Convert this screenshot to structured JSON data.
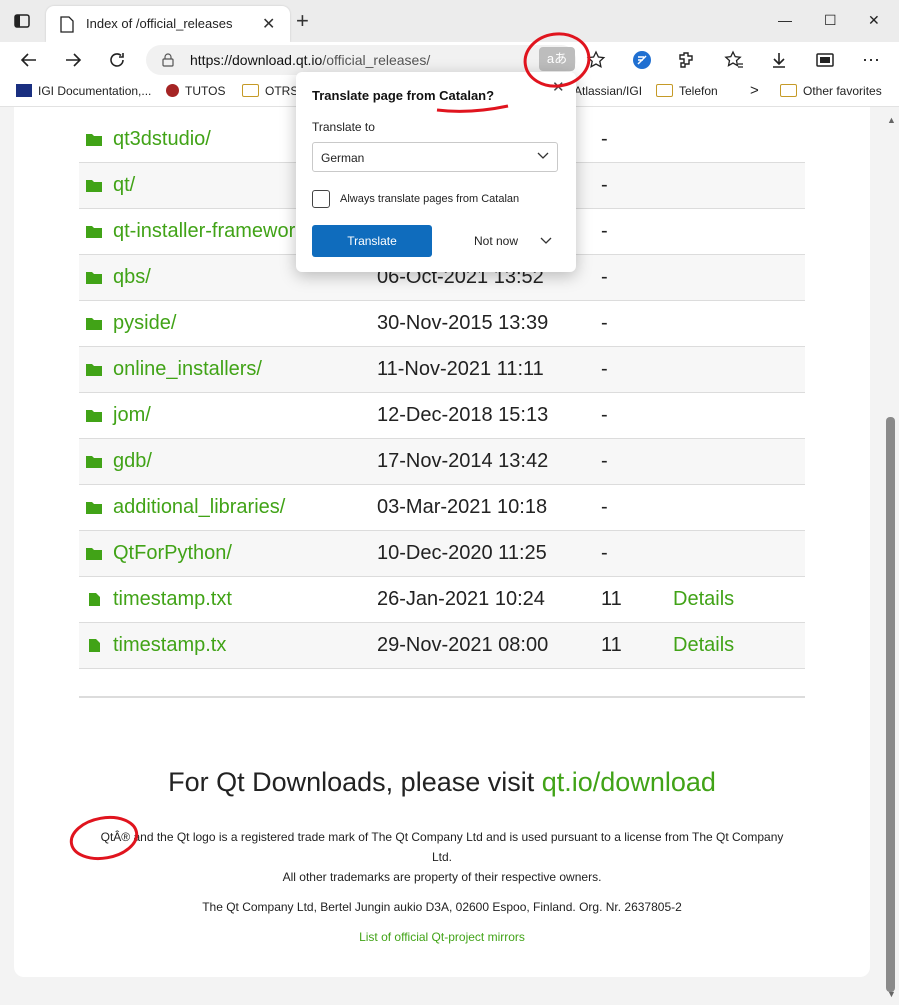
{
  "browser": {
    "tab_title": "Index of /official_releases",
    "url_host": "https://download.qt.io",
    "url_path": "/official_releases/",
    "translate_glyph": "aあ",
    "favorites": [
      {
        "label": "IGI Documentation,..."
      },
      {
        "label": "TUTOS"
      },
      {
        "label": "OTRS"
      },
      {
        "label": "Atlassian/IGI"
      },
      {
        "label": "Telefon"
      },
      {
        "label": "Other favorites"
      }
    ],
    "more_favorites": ">"
  },
  "listing": {
    "rows": [
      {
        "name": "qt3dstudio/",
        "date": "",
        "size": "-",
        "details": "",
        "icon": "folder-icon"
      },
      {
        "name": "qt/",
        "date": "",
        "size": "-",
        "details": "",
        "icon": "folder-icon"
      },
      {
        "name": "qt-installer-framework/",
        "date": "",
        "size": "-",
        "details": "",
        "icon": "folder-icon"
      },
      {
        "name": "qbs/",
        "date": "06-Oct-2021 13:52",
        "size": "-",
        "details": "",
        "icon": "folder-icon"
      },
      {
        "name": "pyside/",
        "date": "30-Nov-2015 13:39",
        "size": "-",
        "details": "",
        "icon": "folder-icon"
      },
      {
        "name": "online_installers/",
        "date": "11-Nov-2021 11:11",
        "size": "-",
        "details": "",
        "icon": "folder-icon"
      },
      {
        "name": "jom/",
        "date": "12-Dec-2018 15:13",
        "size": "-",
        "details": "",
        "icon": "folder-icon"
      },
      {
        "name": "gdb/",
        "date": "17-Nov-2014 13:42",
        "size": "-",
        "details": "",
        "icon": "folder-icon"
      },
      {
        "name": "additional_libraries/",
        "date": "03-Mar-2021 10:18",
        "size": "-",
        "details": "",
        "icon": "folder-icon"
      },
      {
        "name": "QtForPython/",
        "date": "10-Dec-2020 11:25",
        "size": "-",
        "details": "",
        "icon": "folder-icon"
      },
      {
        "name": "timestamp.txt",
        "date": "26-Jan-2021 10:24",
        "size": "11",
        "details": "Details",
        "icon": "file-icon"
      },
      {
        "name": "timestamp.tx",
        "date": "29-Nov-2021 08:00",
        "size": "11",
        "details": "Details",
        "icon": "file-icon"
      }
    ]
  },
  "footer": {
    "visit_text": "For Qt Downloads, please visit ",
    "visit_link": "qt.io/download",
    "trademark_line1": "QtÂ® and the Qt logo is a registered trade mark of The Qt Company Ltd and is used pursuant to a license from The Qt Company",
    "trademark_line2": "Ltd.",
    "trademark_line3": "All other trademarks are property of their respective owners.",
    "address": "The Qt Company Ltd, Bertel Jungin aukio D3A, 02600 Espoo, Finland. Org. Nr. 2637805-2",
    "mirrors_link": "List of official Qt-project mirrors"
  },
  "translate_popup": {
    "title_prefix": "Translate page from ",
    "title_language": "Catalan?",
    "translate_to_label": "Translate to",
    "selected_language": "German",
    "always_label": "Always translate pages from Catalan",
    "translate_button": "Translate",
    "not_now": "Not now"
  },
  "colors": {
    "link_green": "#41a317",
    "accent_blue": "#0f6cbd",
    "annotation_red": "#e0141e"
  }
}
